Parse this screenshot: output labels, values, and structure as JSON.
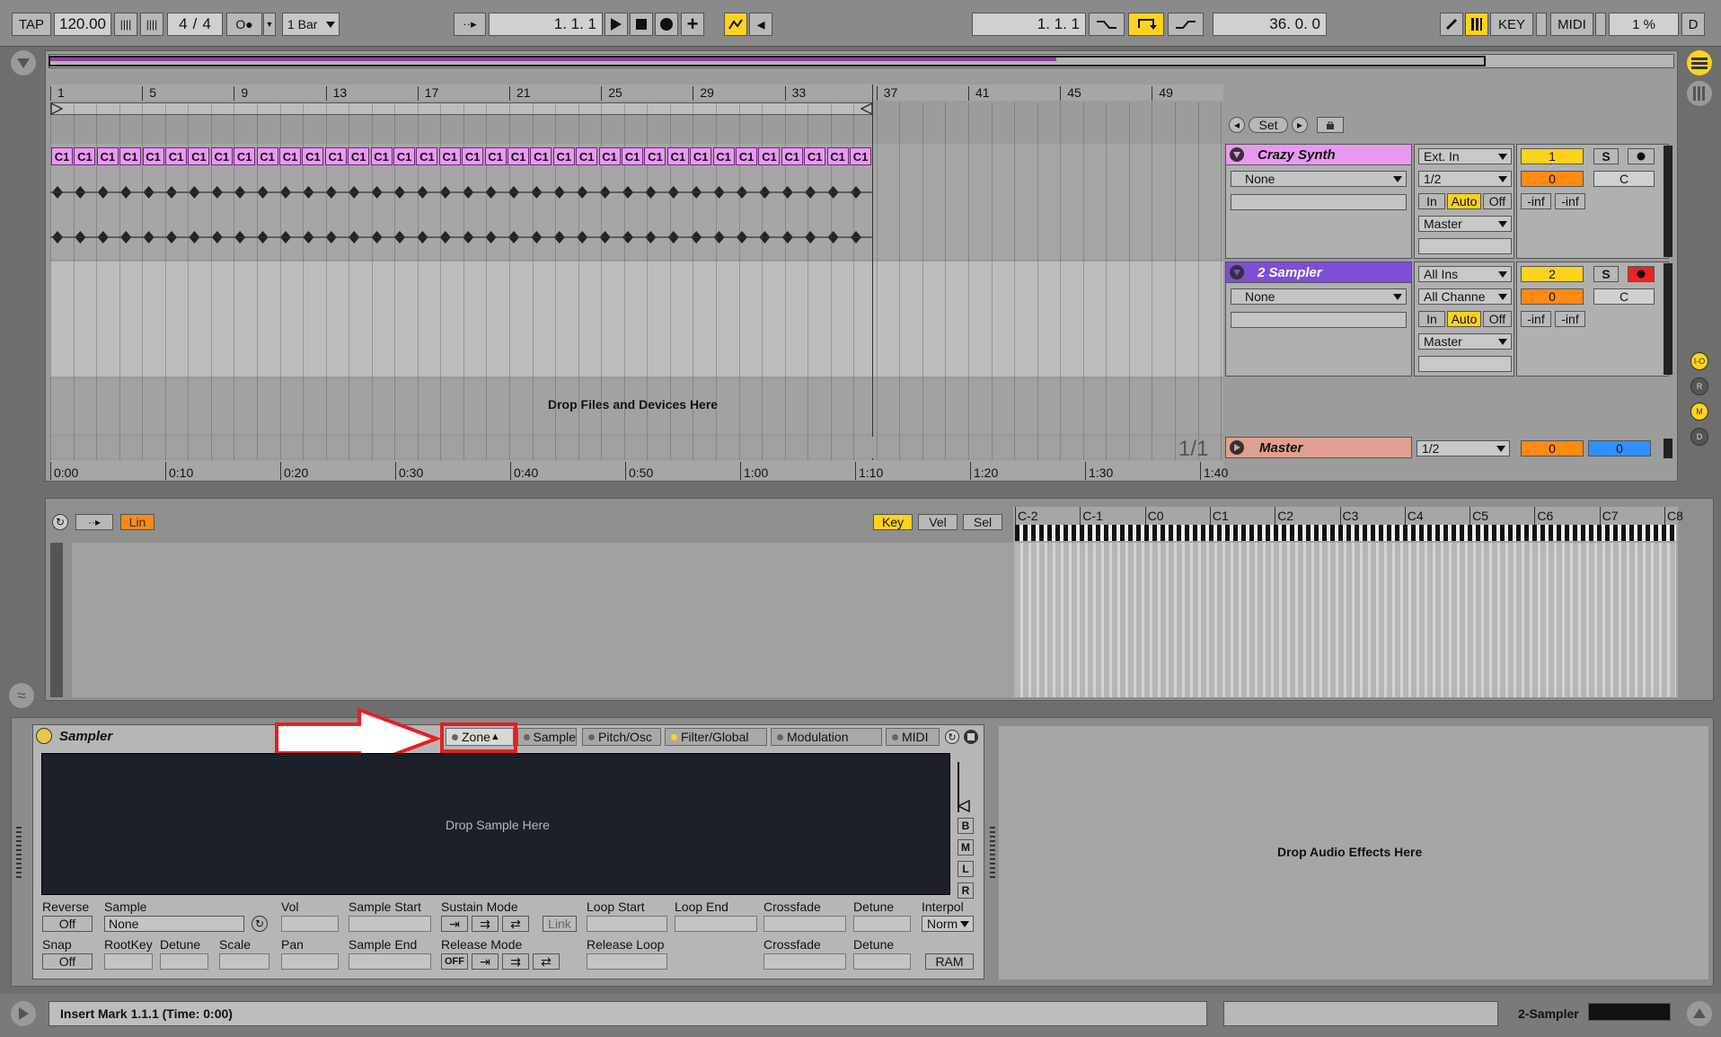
{
  "transport": {
    "tap": "TAP",
    "tempo": "120.00",
    "signature_num": "4",
    "signature_den": "4",
    "quantize": "1 Bar",
    "arr_position": "1.   1.   1",
    "punch_position": "1.   1.   1",
    "loop_length": "36.   0.   0",
    "key": "KEY",
    "midi": "MIDI",
    "cpu": "1 %",
    "d": "D"
  },
  "arrangement": {
    "bar_numbers": [
      "1",
      "5",
      "9",
      "13",
      "17",
      "21",
      "25",
      "29",
      "33",
      "37",
      "41",
      "45",
      "49"
    ],
    "time_labels": [
      "0:00",
      "0:10",
      "0:20",
      "0:30",
      "0:40",
      "0:50",
      "1:00",
      "1:10",
      "1:20",
      "1:30",
      "1:40"
    ],
    "clip_label": "C1",
    "drop_hint": "Drop Files and Devices Here",
    "set_label": "Set",
    "zoom_ratio": "1/1"
  },
  "tracks": [
    {
      "name": "Crazy Synth",
      "device_chooser": "None",
      "input_type": "Ext. In",
      "input_channel": "1/2",
      "monitor_in": "In",
      "monitor_auto": "Auto",
      "monitor_off": "Off",
      "output": "Master",
      "number": "1",
      "solo": "S",
      "volume": "0",
      "pan": "C",
      "peak_l": "-inf",
      "peak_r": "-inf",
      "color": "#e89af0"
    },
    {
      "name": "2 Sampler",
      "device_chooser": "None",
      "input_type": "All Ins",
      "input_channel": "All Channe",
      "monitor_in": "In",
      "monitor_auto": "Auto",
      "monitor_off": "Off",
      "output": "Master",
      "number": "2",
      "solo": "S",
      "volume": "0",
      "pan": "C",
      "peak_l": "-inf",
      "peak_r": "-inf",
      "color": "#7d4fd6"
    }
  ],
  "master": {
    "name": "Master",
    "channel": "1/2",
    "volume": "0",
    "cue": "0",
    "color": "#e0a090"
  },
  "clip_view": {
    "lin": "Lin",
    "key": "Key",
    "vel": "Vel",
    "sel": "Sel",
    "octaves": [
      "C-2",
      "C-1",
      "C0",
      "C1",
      "C2",
      "C3",
      "C4",
      "C5",
      "C6",
      "C7",
      "C8"
    ]
  },
  "side_buttons": [
    "I-O",
    "R",
    "M",
    "D"
  ],
  "sampler": {
    "title": "Sampler",
    "tabs": [
      "Zone",
      "Sample",
      "Pitch/Osc",
      "Filter/Global",
      "Modulation",
      "MIDI"
    ],
    "drop_hint": "Drop Sample Here",
    "side_buttons": [
      "B",
      "M",
      "L",
      "R"
    ],
    "labels": {
      "reverse": "Reverse",
      "sample": "Sample",
      "vol": "Vol",
      "sample_start": "Sample Start",
      "sustain_mode": "Sustain Mode",
      "loop_start": "Loop Start",
      "loop_end": "Loop End",
      "crossfade": "Crossfade",
      "detune": "Detune",
      "interpol": "Interpol",
      "snap": "Snap",
      "rootkey": "RootKey",
      "detune2": "Detune",
      "scale": "Scale",
      "pan": "Pan",
      "sample_end": "Sample End",
      "release_mode": "Release Mode",
      "release_loop": "Release Loop",
      "crossfade2": "Crossfade",
      "detune3": "Detune"
    },
    "values": {
      "reverse": "Off",
      "sample": "None",
      "snap": "Off",
      "link": "Link",
      "interpol": "Norm",
      "ram": "RAM",
      "release_off": "OFF"
    }
  },
  "audio_effects_hint": "Drop Audio Effects Here",
  "status": {
    "text": "Insert Mark 1.1.1 (Time: 0:00)",
    "selected_track": "2-Sampler"
  }
}
